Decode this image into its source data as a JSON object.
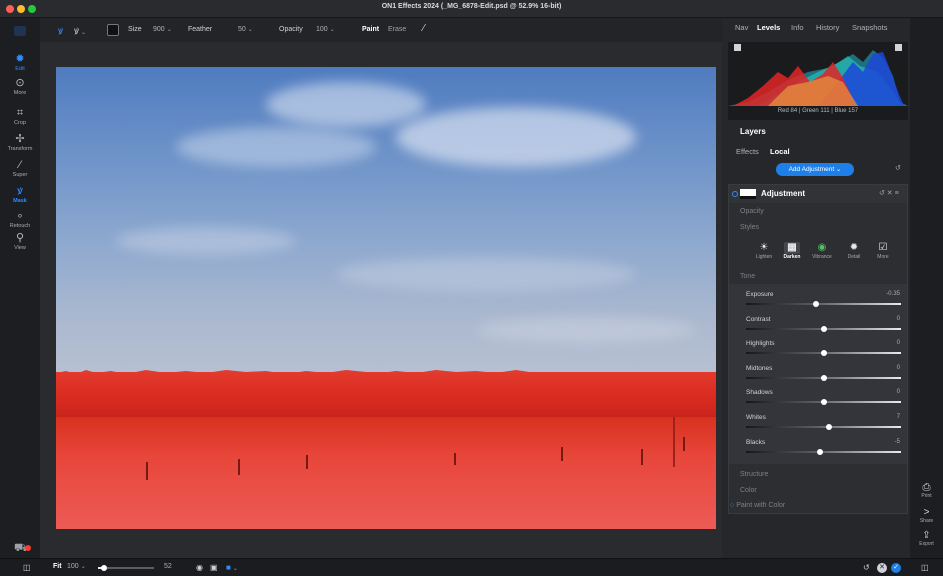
{
  "window": {
    "title": "ON1 Effects 2024 (_MG_6878-Edit.psd @ 52.9% 16-bit)"
  },
  "toolbar": {
    "size_label": "Size",
    "size_value": "900",
    "feather_label": "Feather",
    "feather_value": "50",
    "opacity_label": "Opacity",
    "opacity_value": "100",
    "paint_label": "Paint",
    "erase_label": "Erase"
  },
  "left_sidebar": {
    "items": [
      {
        "label": "Edit",
        "icon": "edit-icon",
        "active": true
      },
      {
        "label": "More",
        "icon": "more-icon",
        "active": false
      },
      {
        "label": "Crop",
        "icon": "crop-icon",
        "active": false
      },
      {
        "label": "Transform",
        "icon": "transform-icon",
        "active": false
      },
      {
        "label": "Super",
        "icon": "super-icon",
        "active": false
      },
      {
        "label": "Mask",
        "icon": "mask-icon",
        "active": true
      },
      {
        "label": "Retouch",
        "icon": "retouch-icon",
        "active": false
      },
      {
        "label": "View",
        "icon": "view-icon",
        "active": false
      }
    ]
  },
  "right_panel": {
    "tabs": [
      "Nav",
      "Levels",
      "Info",
      "History",
      "Snapshots"
    ],
    "active_tab": "Levels",
    "histogram_readout": "Red 84 | Green 111 | Blue 157",
    "layers_title": "Layers",
    "subtabs": [
      "Effects",
      "Local"
    ],
    "active_subtab": "Local",
    "add_adjustment_label": "Add Adjustment",
    "adjustment": {
      "title": "Adjustment",
      "opacity_label": "Opacity",
      "styles_label": "Styles",
      "styles": [
        {
          "label": "Lighten",
          "icon": "lighten-icon"
        },
        {
          "label": "Darken",
          "icon": "darken-icon",
          "active": true
        },
        {
          "label": "Vibrance",
          "icon": "vibrance-icon"
        },
        {
          "label": "Detail",
          "icon": "detail-icon"
        },
        {
          "label": "More",
          "icon": "more-styles-icon"
        }
      ],
      "tone_label": "Tone",
      "sliders": [
        {
          "label": "Exposure",
          "value": "-0.35",
          "level": 0.45
        },
        {
          "label": "Contrast",
          "value": "0",
          "level": 0.5
        },
        {
          "label": "Highlights",
          "value": "0",
          "level": 0.5
        },
        {
          "label": "Midtones",
          "value": "0",
          "level": 0.5
        },
        {
          "label": "Shadows",
          "value": "0",
          "level": 0.5
        },
        {
          "label": "Whites",
          "value": "7",
          "level": 0.535
        },
        {
          "label": "Blacks",
          "value": "-5",
          "level": 0.475
        }
      ],
      "structure_label": "Structure",
      "color_label": "Color",
      "paint_with_color_label": "Paint with Color"
    }
  },
  "far_right": {
    "items": [
      {
        "label": "Print",
        "icon": "print-icon"
      },
      {
        "label": "Share",
        "icon": "share-icon"
      },
      {
        "label": "Export",
        "icon": "export-icon"
      }
    ]
  },
  "bottom_bar": {
    "fit_label": "Fit",
    "zoom_value": "100",
    "brush_value": "52",
    "zoom_slider_level": 0.1
  },
  "colors": {
    "accent": "#1f7fe8",
    "mask_overlay": "#e23a2c"
  }
}
